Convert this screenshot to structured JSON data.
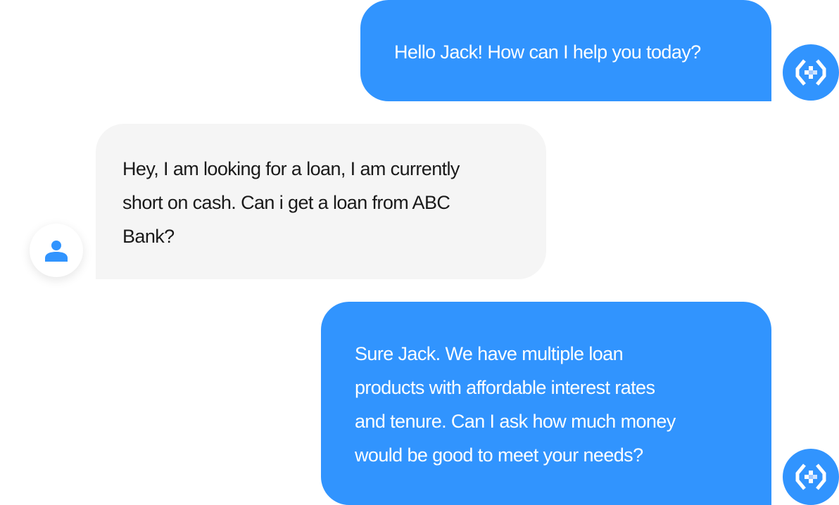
{
  "colors": {
    "bot_bubble": "#3194fe",
    "user_bubble": "#f5f5f5",
    "user_icon": "#3194fe"
  },
  "messages": [
    {
      "sender": "bot",
      "text": "Hello Jack! How can I help you today?",
      "avatar_icon": "bot-logo-icon"
    },
    {
      "sender": "user",
      "lines": [
        "Hey, I am looking for a loan, I am currently",
        "short on cash.  Can i get a loan from ABC",
        "Bank?"
      ],
      "avatar_icon": "user-icon"
    },
    {
      "sender": "bot",
      "lines": [
        "Sure Jack. We have multiple loan",
        "products with affordable interest rates",
        "and tenure. Can I ask how much money",
        "would be good to meet your needs?"
      ],
      "avatar_icon": "bot-logo-icon"
    }
  ]
}
